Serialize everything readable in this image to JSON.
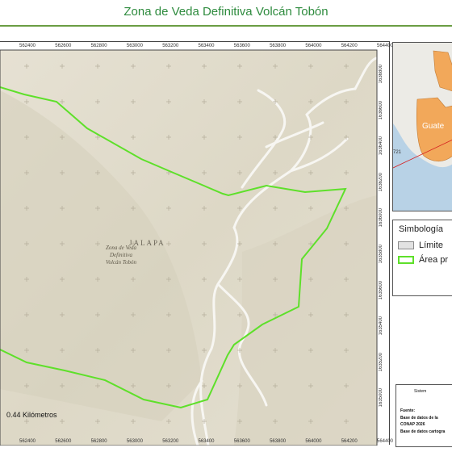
{
  "title": "Zona de Veda Definitiva Volcán Tobón",
  "map": {
    "x_ticks": [
      "562400",
      "562600",
      "562800",
      "563000",
      "563200",
      "563400",
      "563600",
      "563800",
      "564000",
      "564200",
      "564400"
    ],
    "y_ticks": [
      "1636800",
      "1636600",
      "1636400",
      "1636200",
      "1636000",
      "1635800",
      "1635600",
      "1635400",
      "1635200",
      "1635000"
    ],
    "area_label_lines": [
      "Zona de Veda",
      "Definitiva",
      "Volcán Tobón"
    ],
    "region_label": "JALAPA",
    "polygon_color": "#5ee02a"
  },
  "inset": {
    "country_label": "Guate",
    "road_label": "721"
  },
  "legend": {
    "title": "Simbología",
    "items": [
      {
        "label": "Límite",
        "fill": "#e2e2e2",
        "stroke": "#8a8a8a"
      },
      {
        "label": "Área pr",
        "fill": "#ffffff",
        "stroke": "#5ee02a"
      }
    ]
  },
  "source": {
    "header": "Sistem",
    "lines": [
      "Fuente:",
      "Base de datos de la",
      "CONAP 2026",
      "Base de datos cartogra"
    ]
  },
  "scale_bar": {
    "label": "0.44 Kilómetros"
  }
}
